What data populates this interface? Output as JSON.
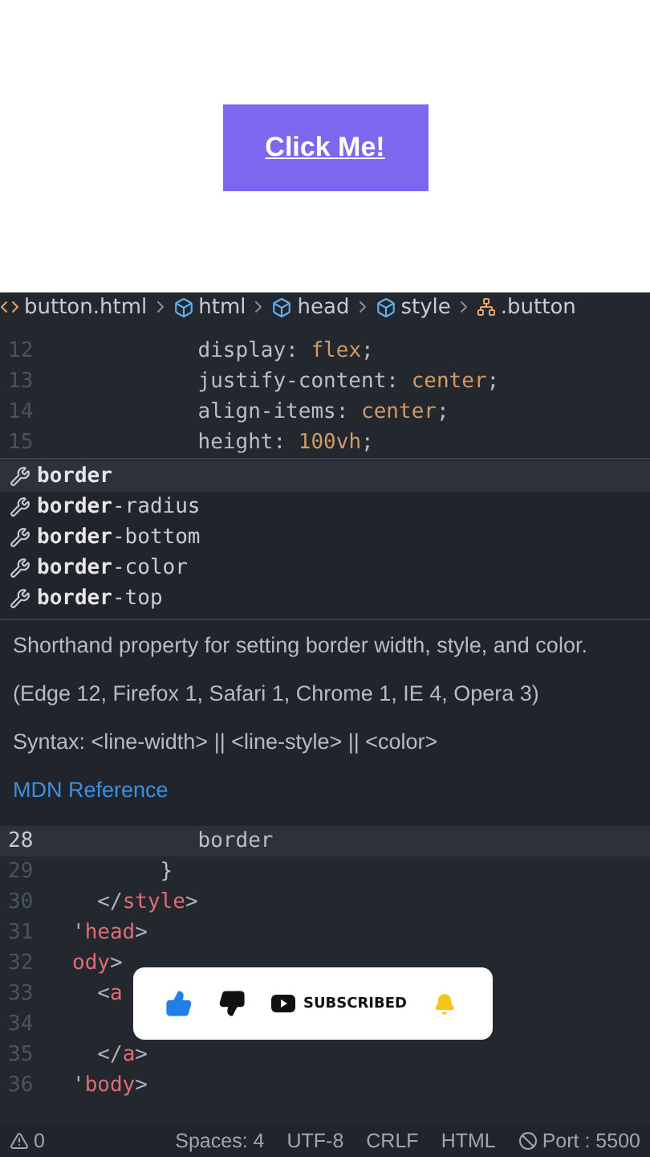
{
  "preview": {
    "button": "Click Me!"
  },
  "breadcrumb": [
    {
      "kind": "file",
      "label": "button.html"
    },
    {
      "kind": "element",
      "label": "html"
    },
    {
      "kind": "element",
      "label": "head"
    },
    {
      "kind": "element",
      "label": "style"
    },
    {
      "kind": "selector",
      "label": ".button"
    }
  ],
  "code_top": [
    {
      "number": "12",
      "segments": [
        {
          "text": "          display: ",
          "kind": "plain"
        },
        {
          "text": "flex",
          "kind": "value"
        },
        {
          "text": ";",
          "kind": "plain"
        }
      ]
    },
    {
      "number": "13",
      "segments": [
        {
          "text": "          justify-content: ",
          "kind": "plain"
        },
        {
          "text": "center",
          "kind": "value"
        },
        {
          "text": ";",
          "kind": "plain"
        }
      ]
    },
    {
      "number": "14",
      "segments": [
        {
          "text": "          align-items: ",
          "kind": "plain"
        },
        {
          "text": "center",
          "kind": "value"
        },
        {
          "text": ";",
          "kind": "plain"
        }
      ]
    },
    {
      "number": "15",
      "segments": [
        {
          "text": "          height: ",
          "kind": "plain"
        },
        {
          "text": "100vh",
          "kind": "value"
        },
        {
          "text": ";",
          "kind": "plain"
        }
      ]
    }
  ],
  "suggestions": [
    {
      "label": "**border**",
      "selected": true
    },
    {
      "label": "**border**-radius",
      "selected": false
    },
    {
      "label": "**border**-bottom",
      "selected": false
    },
    {
      "label": "**border**-color",
      "selected": false
    },
    {
      "label": "**border**-top",
      "selected": false
    }
  ],
  "doc": {
    "description": "Shorthand property for setting border width, style, and color.",
    "support": "(Edge 12, Firefox 1, Safari 1, Chrome 1, IE 4, Opera 3)",
    "syntax": "Syntax: <line-width> || <line-style> || <color>",
    "link": "MDN Reference"
  },
  "code_bottom": [
    {
      "number": "28",
      "current": true,
      "segments": [
        {
          "text": "          border",
          "kind": "plain"
        }
      ]
    },
    {
      "number": "29",
      "current": false,
      "segments": [
        {
          "text": "       }",
          "kind": "plain"
        }
      ]
    },
    {
      "number": "30",
      "current": false,
      "segments": [
        {
          "text": "  </",
          "kind": "punct"
        },
        {
          "text": "style",
          "kind": "tag"
        },
        {
          "text": ">",
          "kind": "punct"
        }
      ]
    },
    {
      "number": "31",
      "current": false,
      "segments": [
        {
          "text": "'",
          "kind": "punct"
        },
        {
          "text": "head",
          "kind": "tag"
        },
        {
          "text": ">",
          "kind": "punct"
        }
      ]
    },
    {
      "number": "32",
      "current": false,
      "segments": [
        {
          "text": "ody",
          "kind": "tag"
        },
        {
          "text": ">",
          "kind": "punct"
        }
      ]
    },
    {
      "number": "33",
      "current": false,
      "segments": [
        {
          "text": "  <",
          "kind": "punct"
        },
        {
          "text": "a",
          "kind": "tag"
        }
      ]
    },
    {
      "number": "34",
      "current": false
    },
    {
      "number": "35",
      "current": false,
      "segments": [
        {
          "text": "  </",
          "kind": "punct"
        },
        {
          "text": "a",
          "kind": "tag"
        },
        {
          "text": ">",
          "kind": "punct"
        }
      ]
    },
    {
      "number": "36",
      "current": false,
      "segments": [
        {
          "text": "'",
          "kind": "punct"
        },
        {
          "text": "body",
          "kind": "tag"
        },
        {
          "text": ">",
          "kind": "punct"
        }
      ]
    }
  ],
  "subscribe_overlay": {
    "label": "SUBSCRIBED"
  },
  "status_bar": [
    {
      "kind": "warnings",
      "label": "0"
    },
    {
      "kind": "text",
      "label": "Spaces: 4"
    },
    {
      "kind": "text",
      "label": "UTF-8"
    },
    {
      "kind": "text",
      "label": "CRLF"
    },
    {
      "kind": "text",
      "label": "HTML"
    },
    {
      "kind": "port",
      "label": "Port : 5500"
    }
  ]
}
